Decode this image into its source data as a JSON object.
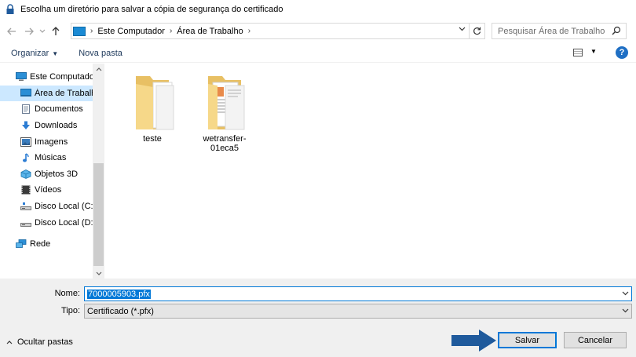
{
  "window": {
    "title": "Escolha um diretório para salvar a cópia de segurança do certificado"
  },
  "address": {
    "crumbs": [
      "Este Computador",
      "Área de Trabalho"
    ],
    "back_icon": "arrow-left-icon",
    "forward_icon": "arrow-right-icon",
    "recent_icon": "chevron-down-icon",
    "up_icon": "arrow-up-icon",
    "refresh_icon": "refresh-icon"
  },
  "search": {
    "placeholder": "Pesquisar Área de Trabalho"
  },
  "toolbar": {
    "organize_label": "Organizar",
    "new_folder_label": "Nova pasta"
  },
  "nav": {
    "items": [
      {
        "label": "Este Computador",
        "icon": "computer-icon",
        "level": 1,
        "selected": false
      },
      {
        "label": "Área de Trabalho",
        "icon": "desktop-icon",
        "level": 2,
        "selected": true
      },
      {
        "label": "Documentos",
        "icon": "document-icon",
        "level": 2,
        "selected": false
      },
      {
        "label": "Downloads",
        "icon": "download-icon",
        "level": 2,
        "selected": false
      },
      {
        "label": "Imagens",
        "icon": "images-icon",
        "level": 2,
        "selected": false
      },
      {
        "label": "Músicas",
        "icon": "music-icon",
        "level": 2,
        "selected": false
      },
      {
        "label": "Objetos 3D",
        "icon": "3d-objects-icon",
        "level": 2,
        "selected": false
      },
      {
        "label": "Vídeos",
        "icon": "video-icon",
        "level": 2,
        "selected": false
      },
      {
        "label": "Disco Local (C:)",
        "icon": "drive-icon",
        "level": 2,
        "selected": false
      },
      {
        "label": "Disco Local (D:)",
        "icon": "drive-icon",
        "level": 2,
        "selected": false
      },
      {
        "label": "Rede",
        "icon": "network-icon",
        "level": 1,
        "selected": false
      }
    ]
  },
  "content": {
    "folders": [
      {
        "name": "teste"
      },
      {
        "name": "wetransfer-01eca5"
      }
    ]
  },
  "form": {
    "name_label": "Nome:",
    "name_value": "7000005903.pfx",
    "type_label": "Tipo:",
    "type_value": "Certificado (*.pfx)"
  },
  "footer": {
    "hide_folders_label": "Ocultar pastas",
    "save_label": "Salvar",
    "cancel_label": "Cancelar"
  },
  "colors": {
    "selection": "#cce8ff",
    "accent": "#0078d7",
    "arrow": "#1f5a9c"
  }
}
